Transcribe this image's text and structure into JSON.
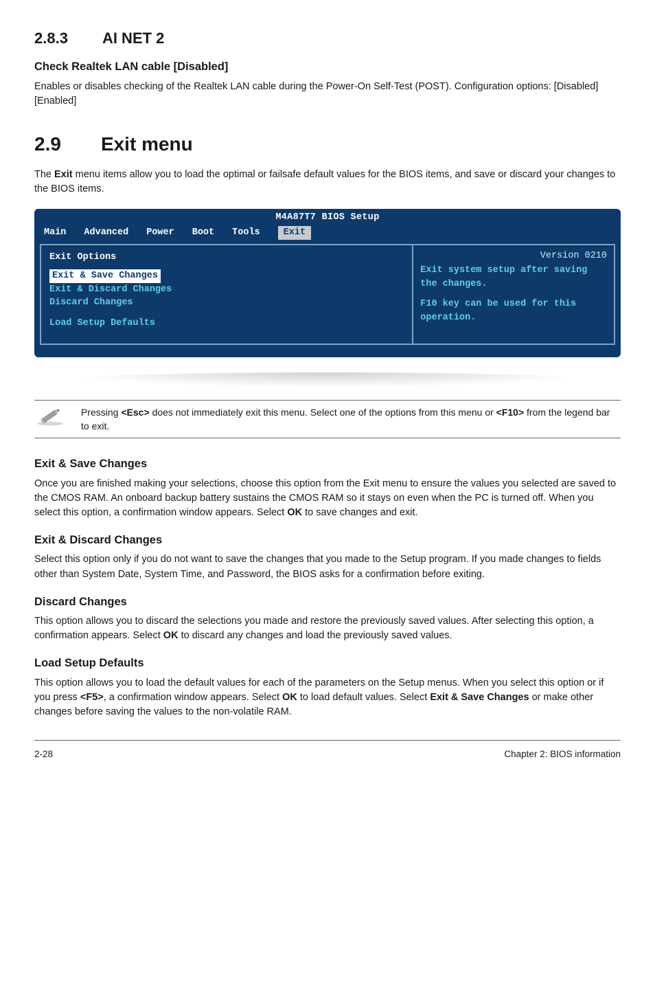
{
  "s283": {
    "num": "2.8.3",
    "title": "AI NET 2",
    "sub_head": "Check Realtek LAN cable [Disabled]",
    "sub_body": "Enables or disables checking of the Realtek LAN cable during the Power-On Self-Test (POST). Configuration options: [Disabled] [Enabled]"
  },
  "s29": {
    "num": "2.9",
    "title": "Exit menu",
    "intro_a": "The ",
    "intro_bold": "Exit",
    "intro_b": " menu items allow you to load the optimal or failsafe default values for the BIOS items, and save or discard your changes to the BIOS items."
  },
  "bios": {
    "title": "M4A87T7 BIOS Setup",
    "tabs": {
      "main": "Main",
      "advanced": "Advanced",
      "power": "Power",
      "boot": "Boot",
      "tools": "Tools",
      "exit": "Exit"
    },
    "left": {
      "header": "Exit Options",
      "items": {
        "save": "Exit & Save Changes",
        "discard_exit": "Exit & Discard Changes",
        "discard": "Discard Changes",
        "load_defaults": "Load Setup Defaults"
      }
    },
    "right": {
      "version": "Version 0210",
      "lines": {
        "l1": "Exit system setup after saving the changes.",
        "l2": "F10 key can be used for this operation."
      }
    }
  },
  "note": {
    "a": "Pressing ",
    "esc": "<Esc>",
    "b": " does not immediately exit this menu. Select one of the options from this menu or ",
    "f10": "<F10>",
    "c": " from the legend bar to exit."
  },
  "exit_save": {
    "head": "Exit & Save Changes",
    "body_a": "Once you are finished making your selections, choose this option from the Exit menu to ensure the values you selected are saved to the CMOS RAM. An onboard backup battery sustains the CMOS RAM so it stays on even when the PC is turned off. When you select this option, a confirmation window appears. Select ",
    "ok": "OK",
    "body_b": " to save changes and exit."
  },
  "exit_discard": {
    "head": "Exit & Discard Changes",
    "body": "Select this option only if you do not want to save the changes that you made to the Setup program. If you made changes to fields other than System Date, System Time, and Password, the BIOS asks for a confirmation before exiting."
  },
  "discard": {
    "head": "Discard Changes",
    "body_a": "This option allows you to discard the selections you made and restore the previously saved values. After selecting this option, a confirmation appears. Select ",
    "ok": "OK",
    "body_b": " to discard any changes and load the previously saved values."
  },
  "load_defaults": {
    "head": "Load Setup Defaults",
    "body_a": "This option allows you to load the default values for each of the parameters on the Setup menus. When you select this option or if you press ",
    "f5": "<F5>",
    "body_b": ", a confirmation window appears. Select ",
    "ok": "OK",
    "body_c": " to load default values. Select ",
    "esc_label": "Exit & Save Changes",
    "body_d": " or make other changes before saving the values to the non-volatile RAM."
  },
  "footer": {
    "left": "2-28",
    "right": "Chapter 2: BIOS information"
  }
}
